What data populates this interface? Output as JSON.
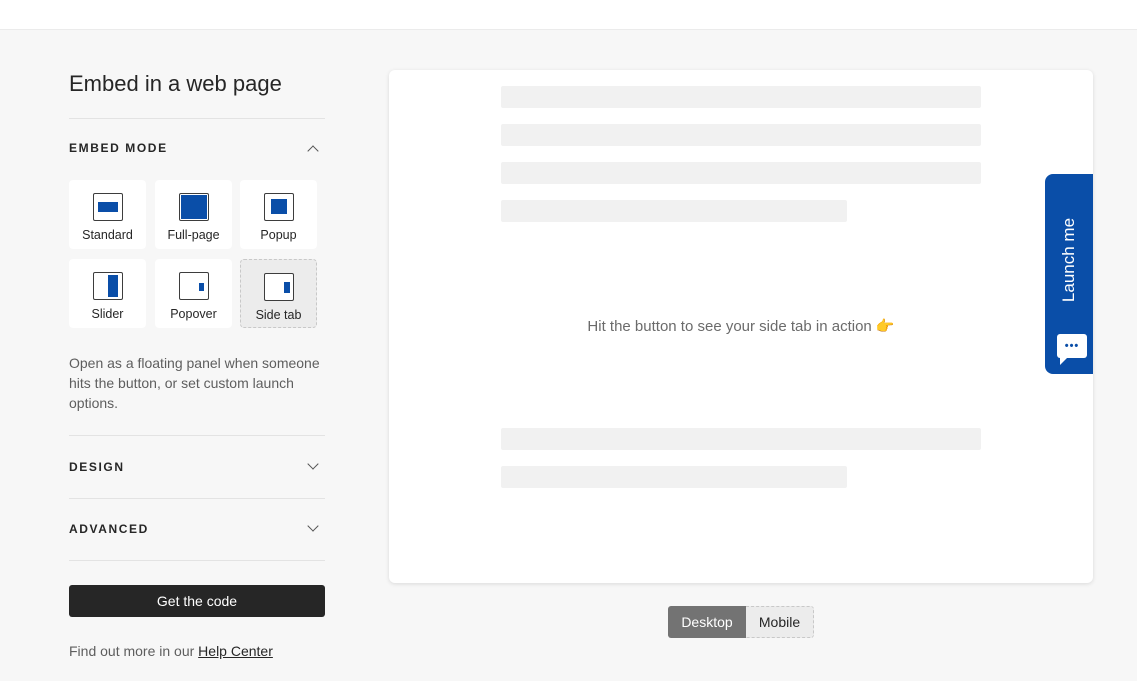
{
  "page": {
    "title": "Embed in a web page"
  },
  "embed_mode": {
    "heading": "EMBED MODE",
    "expanded": true,
    "modes": [
      {
        "label": "Standard",
        "icon": "standard-mode-icon",
        "selected": false
      },
      {
        "label": "Full-page",
        "icon": "full-page-mode-icon",
        "selected": false
      },
      {
        "label": "Popup",
        "icon": "popup-mode-icon",
        "selected": false
      },
      {
        "label": "Slider",
        "icon": "slider-mode-icon",
        "selected": false
      },
      {
        "label": "Popover",
        "icon": "popover-mode-icon",
        "selected": false
      },
      {
        "label": "Side tab",
        "icon": "side-tab-mode-icon",
        "selected": true
      }
    ],
    "description": "Open as a floating panel when someone hits the button, or set custom launch options."
  },
  "design": {
    "heading": "DESIGN",
    "expanded": false
  },
  "advanced": {
    "heading": "ADVANCED",
    "expanded": false
  },
  "actions": {
    "get_code": "Get the code"
  },
  "help": {
    "prefix": "Find out more in our ",
    "link": "Help Center"
  },
  "preview": {
    "hint": "Hit the button to see your side tab in action 👉",
    "side_tab_label": "Launch me",
    "side_tab_icon": "chat-bubble-icon",
    "view_toggle": {
      "options": [
        "Desktop",
        "Mobile"
      ],
      "selected": "Desktop"
    }
  },
  "colors": {
    "accent": "#0a4ea8",
    "dark": "#262626",
    "background": "#f7f7f7"
  }
}
